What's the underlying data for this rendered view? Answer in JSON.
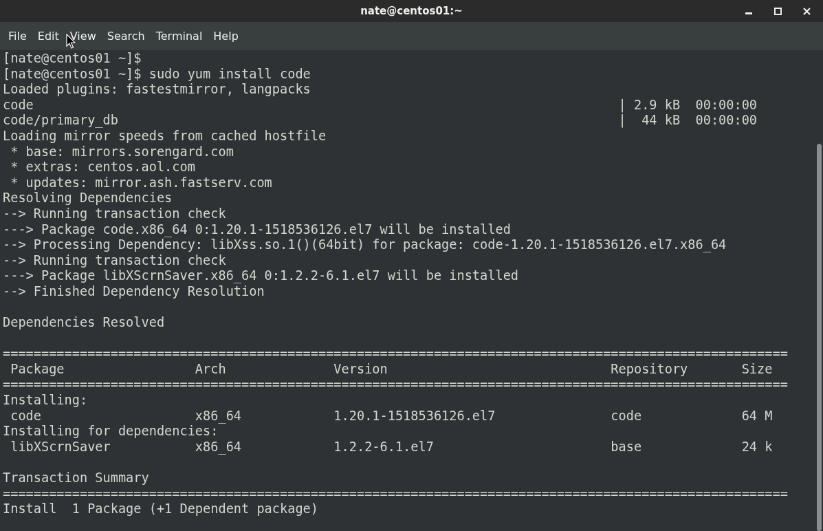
{
  "window": {
    "title": "nate@centos01:~"
  },
  "menu": [
    "File",
    "Edit",
    "View",
    "Search",
    "Terminal",
    "Help"
  ],
  "terminal": {
    "lines": [
      {
        "kind": "text",
        "text": "[nate@centos01 ~]$"
      },
      {
        "kind": "text",
        "text": "[nate@centos01 ~]$ sudo yum install code"
      },
      {
        "kind": "text",
        "text": "Loaded plugins: fastestmirror, langpacks"
      },
      {
        "kind": "text",
        "text": "code                                                                            | 2.9 kB  00:00:00"
      },
      {
        "kind": "text",
        "text": "code/primary_db                                                                 |  44 kB  00:00:00"
      },
      {
        "kind": "text",
        "text": "Loading mirror speeds from cached hostfile"
      },
      {
        "kind": "text",
        "text": " * base: mirrors.sorengard.com"
      },
      {
        "kind": "text",
        "text": " * extras: centos.aol.com"
      },
      {
        "kind": "text",
        "text": " * updates: mirror.ash.fastserv.com"
      },
      {
        "kind": "text",
        "text": "Resolving Dependencies"
      },
      {
        "kind": "text",
        "text": "--> Running transaction check"
      },
      {
        "kind": "text",
        "text": "---> Package code.x86_64 0:1.20.1-1518536126.el7 will be installed"
      },
      {
        "kind": "text",
        "text": "--> Processing Dependency: libXss.so.1()(64bit) for package: code-1.20.1-1518536126.el7.x86_64"
      },
      {
        "kind": "text",
        "text": "--> Running transaction check"
      },
      {
        "kind": "text",
        "text": "---> Package libXScrnSaver.x86_64 0:1.2.2-6.1.el7 will be installed"
      },
      {
        "kind": "text",
        "text": "--> Finished Dependency Resolution"
      },
      {
        "kind": "blank"
      },
      {
        "kind": "text",
        "text": "Dependencies Resolved"
      },
      {
        "kind": "blank"
      },
      {
        "kind": "text",
        "text": "======================================================================================================"
      },
      {
        "kind": "text",
        "text": " Package                 Arch              Version                             Repository       Size"
      },
      {
        "kind": "text",
        "text": "======================================================================================================"
      },
      {
        "kind": "text",
        "text": "Installing:"
      },
      {
        "kind": "text",
        "text": " code                    x86_64            1.20.1-1518536126.el7               code             64 M"
      },
      {
        "kind": "text",
        "text": "Installing for dependencies:"
      },
      {
        "kind": "text",
        "text": " libXScrnSaver           x86_64            1.2.2-6.1.el7                       base             24 k"
      },
      {
        "kind": "blank"
      },
      {
        "kind": "text",
        "text": "Transaction Summary"
      },
      {
        "kind": "text",
        "text": "======================================================================================================"
      },
      {
        "kind": "text",
        "text": "Install  1 Package (+1 Dependent package)"
      }
    ]
  }
}
